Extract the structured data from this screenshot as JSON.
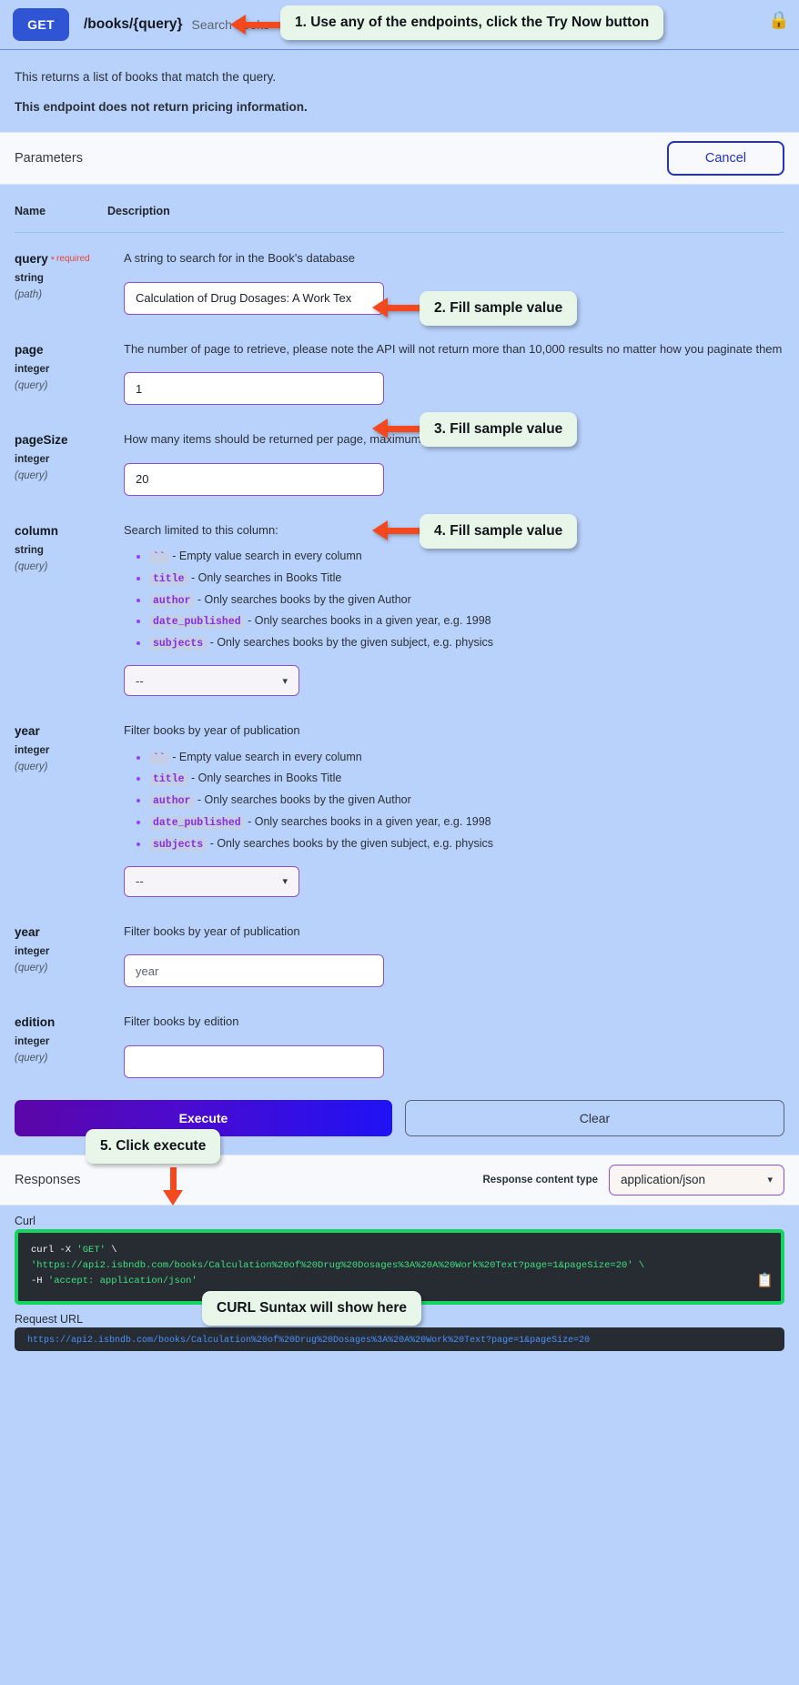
{
  "operation": {
    "method": "GET",
    "path": "/books/{query}",
    "summary": "Search books",
    "lock_icon": "lock-icon",
    "description_1": "This returns a list of books that match the query.",
    "description_2": "This endpoint does not return pricing information."
  },
  "parameters_section": {
    "title": "Parameters",
    "cancel_label": "Cancel",
    "col_name": "Name",
    "col_description": "Description"
  },
  "parameters": [
    {
      "name": "query",
      "required_star": "*",
      "required_label": "required",
      "type": "string",
      "location": "(path)",
      "description": "A string to search for in the Book's database",
      "value": "Calculation of Drug Dosages: A Work Tex",
      "control": "input"
    },
    {
      "name": "page",
      "type": "integer",
      "location": "(query)",
      "description": "The number of page to retrieve, please note the API will not return more than 10,000 results no matter how you paginate them",
      "value": "1",
      "control": "input"
    },
    {
      "name": "pageSize",
      "type": "integer",
      "location": "(query)",
      "description": "How many items should be returned per page, maximum of 1,000",
      "value": "20",
      "control": "input"
    },
    {
      "name": "column",
      "type": "string",
      "location": "(query)",
      "description": "Search limited to this column:",
      "bullets": [
        {
          "code": "``",
          "text": "- Empty value search in every column"
        },
        {
          "code": "title",
          "text": "- Only searches in Books Title"
        },
        {
          "code": "author",
          "text": "- Only searches books by the given Author"
        },
        {
          "code": "date_published",
          "text": "- Only searches books in a given year, e.g. 1998"
        },
        {
          "code": "subjects",
          "text": "- Only searches books by the given subject, e.g. physics"
        }
      ],
      "value": "--",
      "control": "select"
    },
    {
      "name": "year",
      "type": "integer",
      "location": "(query)",
      "description": "Filter books by year of publication",
      "bullets": [
        {
          "code": "``",
          "text": "- Empty value search in every column"
        },
        {
          "code": "title",
          "text": "- Only searches in Books Title"
        },
        {
          "code": "author",
          "text": "- Only searches books by the given Author"
        },
        {
          "code": "date_published",
          "text": "- Only searches books in a given year, e.g. 1998"
        },
        {
          "code": "subjects",
          "text": "- Only searches books by the given subject, e.g. physics"
        }
      ],
      "value": "--",
      "control": "select"
    },
    {
      "name": "year",
      "type": "integer",
      "location": "(query)",
      "description": "Filter books by year of publication",
      "placeholder": "year",
      "value": "",
      "control": "input"
    },
    {
      "name": "edition",
      "type": "integer",
      "location": "(query)",
      "description": "Filter books by edition",
      "placeholder": "",
      "value": "",
      "control": "input"
    }
  ],
  "actions": {
    "execute_label": "Execute",
    "clear_label": "Clear"
  },
  "responses_section": {
    "title": "Responses",
    "content_type_label": "Response content type",
    "content_type_value": "application/json",
    "chevron_icon": "chevron-down-icon"
  },
  "curl": {
    "label": "Curl",
    "line1_cmd": "curl -X ",
    "line1_method": "'GET'",
    "line1_tail": " \\",
    "line2": "'https://api2.isbndb.com/books/Calculation%20of%20Drug%20Dosages%3A%20A%20Work%20Text?page=1&pageSize=20' \\",
    "line3_flag": "-H ",
    "line3_val": "'accept: application/json'",
    "copy_icon": "copy-icon"
  },
  "request_url": {
    "label": "Request URL",
    "value": "https://api2.isbndb.com/books/Calculation%20of%20Drug%20Dosages%3A%20A%20Work%20Text?page=1&pageSize=20"
  },
  "annotations": [
    {
      "id": "a1",
      "text": "1. Use any of the endpoints, click the Try Now button"
    },
    {
      "id": "a2",
      "text": "2. Fill sample value"
    },
    {
      "id": "a3",
      "text": "3. Fill sample value"
    },
    {
      "id": "a4",
      "text": "4. Fill sample value"
    },
    {
      "id": "a5",
      "text": "5. Click execute"
    },
    {
      "id": "a6",
      "text": "CURL Suntax will show here"
    }
  ],
  "colors": {
    "page_bg": "#b9d2fb",
    "verb_bg": "#2f54d4",
    "accent_purple": "#8a4fd6",
    "arrow": "#f4491f",
    "callout_bg": "#e8f5e9",
    "curl_border": "#14d35f",
    "execute_gradient_from": "#5b06a8",
    "execute_gradient_to": "#1f12f5"
  }
}
